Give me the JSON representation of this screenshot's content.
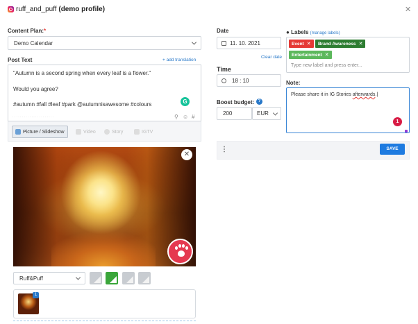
{
  "header": {
    "profile_name": "ruff_and_puff",
    "profile_note": "(demo profile)"
  },
  "content_plan": {
    "label": "Content Plan:",
    "required_mark": "*",
    "selected": "Demo Calendar"
  },
  "post_text": {
    "label": "Post Text",
    "add_translation": "+ add translation",
    "lines": [
      "\"Autumn is a second spring when every leaf is a flower.\"",
      "Would you agree?",
      "#autumn #fall #leaf #park @autumnisawesome #colours"
    ]
  },
  "media_tabs": [
    {
      "label": "Picture / Slideshow",
      "icon": "picture-icon"
    },
    {
      "label": "Video",
      "icon": "video-icon"
    },
    {
      "label": "Story",
      "icon": "story-icon"
    },
    {
      "label": "IGTV",
      "icon": "igtv-icon"
    }
  ],
  "frame": {
    "selected": "Ruff&Puff"
  },
  "thumbnail": {
    "badge": "1"
  },
  "date": {
    "label": "Date",
    "value": "11. 10. 2021",
    "clear": "Clear date"
  },
  "time": {
    "label": "Time",
    "value": "18 : 10"
  },
  "boost": {
    "label": "Boost budget:",
    "amount": "200",
    "currency": "EUR"
  },
  "labels": {
    "label": "Labels",
    "manage": "(manage labels)",
    "chips": [
      {
        "name": "Event",
        "color": "#e53935"
      },
      {
        "name": "Brand Awareness",
        "color": "#2e7d32"
      },
      {
        "name": "Entertainment",
        "color": "#5cb85c"
      }
    ],
    "input_placeholder": "Type new label and press enter..."
  },
  "note": {
    "label": "Note:",
    "text_before": "Please share it in IG Stories ",
    "text_flagged": "afterwards",
    "text_after": ".",
    "badge": "1"
  },
  "footer": {
    "save_label": "SAVE"
  }
}
